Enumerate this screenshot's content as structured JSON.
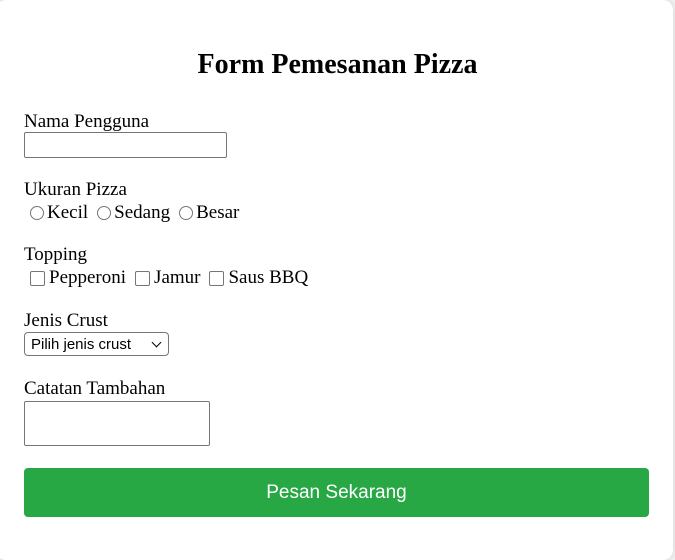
{
  "form": {
    "title": "Form Pemesanan Pizza",
    "name_label": "Nama Pengguna",
    "name_value": "",
    "size_label": "Ukuran Pizza",
    "size_options": [
      "Kecil",
      "Sedang",
      "Besar"
    ],
    "topping_label": "Topping",
    "topping_options": [
      "Pepperoni",
      "Jamur",
      "Saus BBQ"
    ],
    "crust_label": "Jenis Crust",
    "crust_selected": "Pilih jenis crust",
    "notes_label": "Catatan Tambahan",
    "notes_value": "",
    "submit_label": "Pesan Sekarang"
  },
  "colors": {
    "submit_bg": "#28a745",
    "submit_text": "#ffffff",
    "page_bg": "#f0f0f0",
    "card_bg": "#ffffff"
  },
  "icons": {
    "select": "chevron-down-icon",
    "textarea": "resize-handle-icon"
  }
}
